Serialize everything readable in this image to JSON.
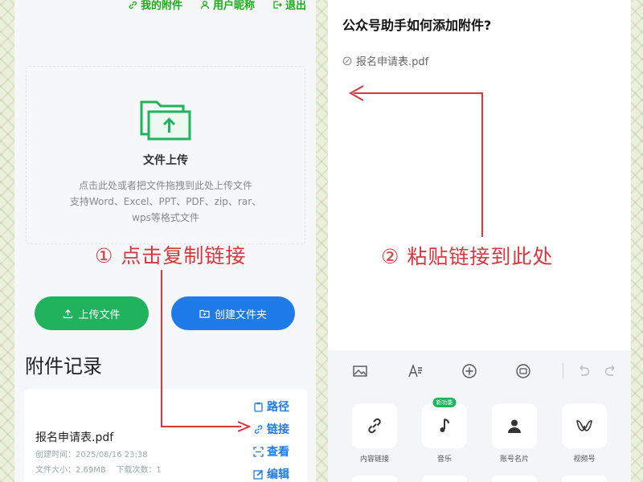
{
  "left_phone": {
    "top_links": [
      {
        "label": "我的附件",
        "icon": "link-icon"
      },
      {
        "label": "用户昵称",
        "icon": "user-icon"
      },
      {
        "label": "退出",
        "icon": "logout-icon"
      }
    ],
    "upload": {
      "icon": "folder-upload-icon",
      "title": "文件上传",
      "desc_line1": "点击此处或者把文件拖拽到此处上传文件",
      "desc_line2": "支持Word、Excel、PPT、PDF、zip、rar、",
      "desc_line3": "wps等格式文件"
    },
    "buttons": {
      "upload_file": "上传文件",
      "create_folder": "创建文件夹"
    },
    "records_title": "附件记录",
    "record": {
      "file_name": "报名申请表.pdf",
      "created": "创建时间：2025/08/16 23:38",
      "size": "文件大小：2.69MB",
      "downloads": "下载次数：1",
      "actions": {
        "path": "路径",
        "link": "链接",
        "view": "查看",
        "edit": "编辑"
      }
    }
  },
  "right_phone": {
    "article_title": "公众号助手如何添加附件?",
    "attachment_name": "报名申请表.pdf",
    "toolbar_icons": [
      "image-icon",
      "text-format-icon",
      "add-circle-icon",
      "emoji-icon",
      "undo-icon",
      "redo-icon"
    ],
    "insert_items": [
      {
        "label": "内容链接",
        "icon": "link-icon",
        "badge": ""
      },
      {
        "label": "音乐",
        "icon": "music-note-icon",
        "badge": "新功能"
      },
      {
        "label": "账号名片",
        "icon": "person-icon",
        "badge": ""
      },
      {
        "label": "视频号",
        "icon": "channels-icon",
        "badge": ""
      }
    ]
  },
  "annotations": {
    "step1": "① 点击复制链接",
    "step2": "② 粘贴链接到此处"
  },
  "colors": {
    "accent_red": "#d9363e",
    "green": "#20b25c",
    "blue": "#1f7be8"
  }
}
